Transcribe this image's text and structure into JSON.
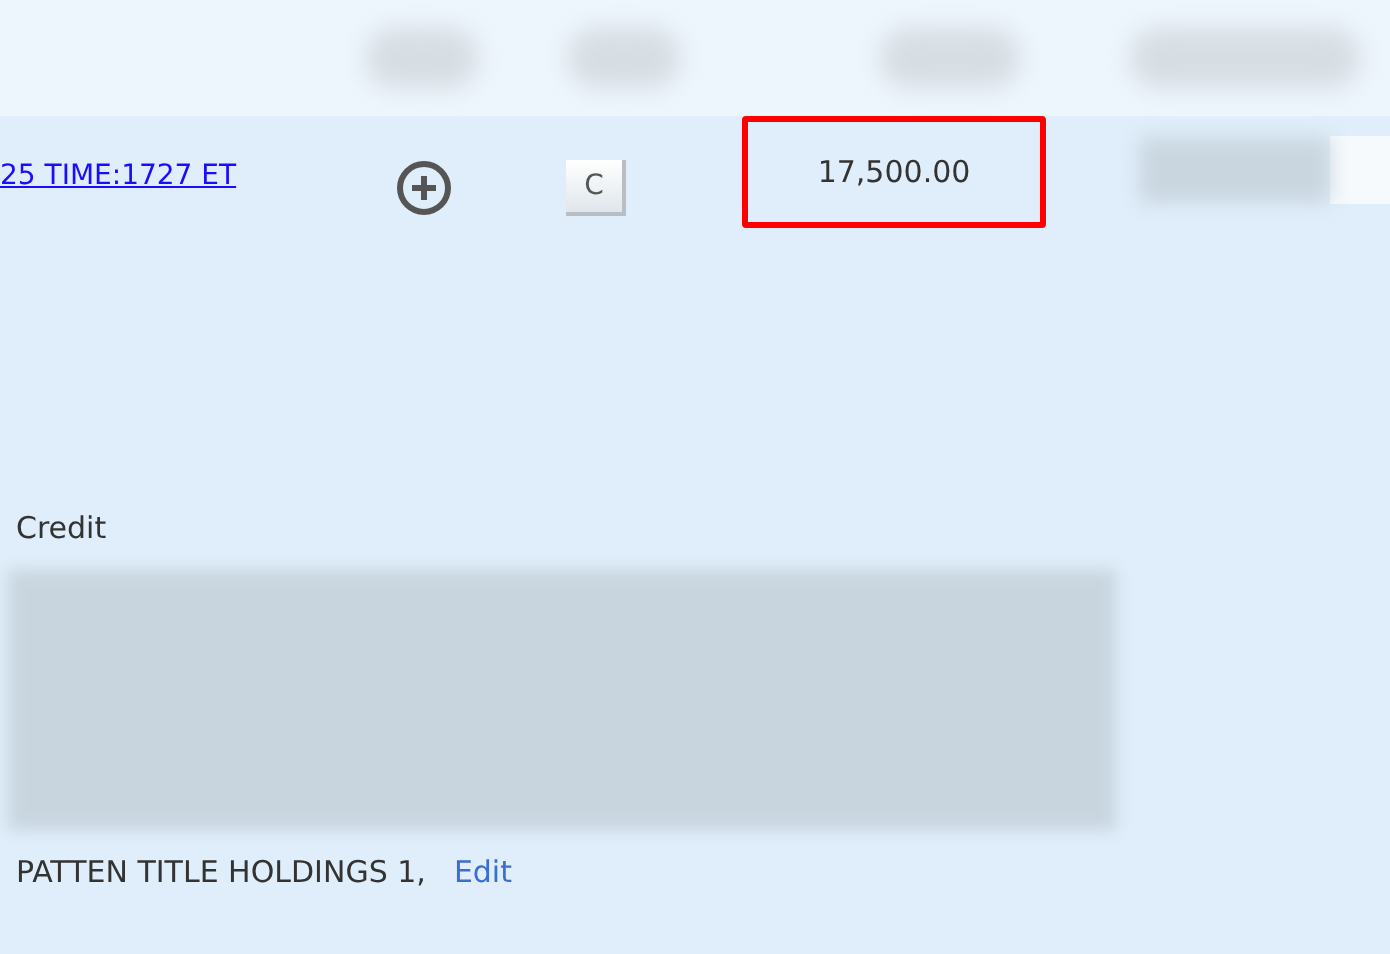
{
  "row": {
    "link": "25 TIME:1727 ET",
    "action_key": "C",
    "amount": "17,500.00",
    "amount_highlighted": true
  },
  "credit": {
    "label": "Credit",
    "name": "PATTEN TITLE HOLDINGS 1,",
    "edit_link": "Edit"
  }
}
